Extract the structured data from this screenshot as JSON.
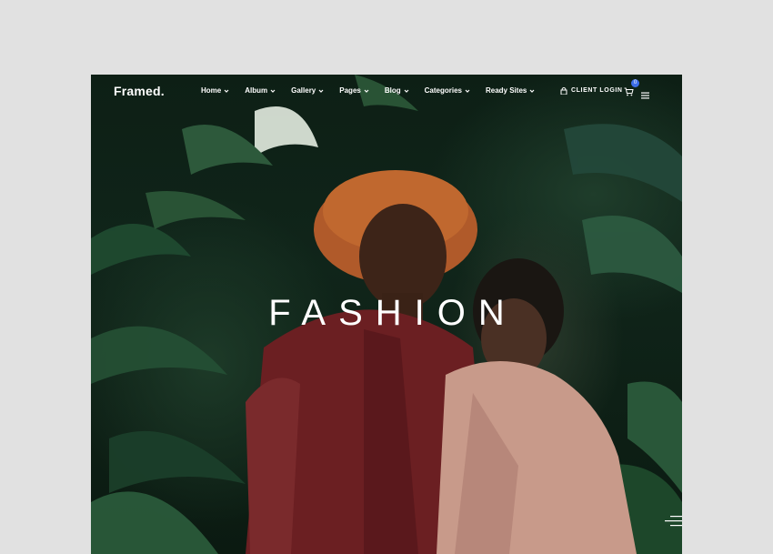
{
  "brand": {
    "logo_text": "Framed."
  },
  "nav": {
    "items": [
      {
        "label": "Home"
      },
      {
        "label": "Album"
      },
      {
        "label": "Gallery"
      },
      {
        "label": "Pages"
      },
      {
        "label": "Blog"
      },
      {
        "label": "Categories"
      },
      {
        "label": "Ready Sites"
      }
    ],
    "client_login": "CLIENT LOGIN",
    "cart_count": "0"
  },
  "hero": {
    "title": "FASHION"
  },
  "colors": {
    "page_background": "#e1e1e1",
    "foliage": "#1d3a28",
    "jacket": "#6b1f22",
    "cardigan": "#c89a8a",
    "badge": "#3d6ee8"
  },
  "icons": [
    "lock-icon",
    "cart-icon",
    "menu-icon",
    "chevron-down-icon",
    "side-menu-icon"
  ]
}
